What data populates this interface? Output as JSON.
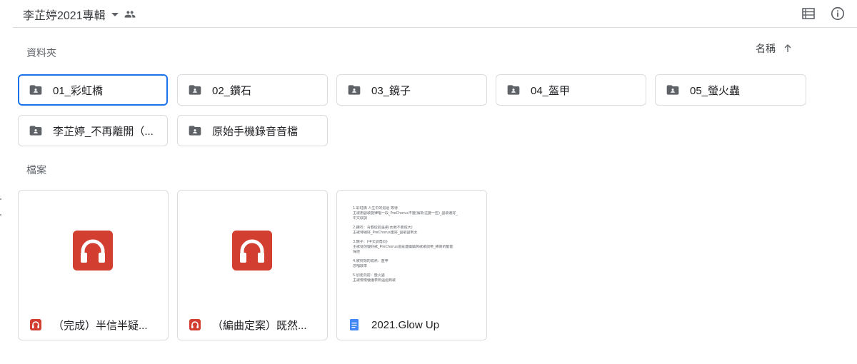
{
  "header": {
    "title": "李芷婷2021專輯",
    "icons": {
      "dropdown": "caret-down-icon",
      "shared": "people-icon",
      "view": "list-view-icon",
      "info": "info-icon"
    }
  },
  "folders_section": {
    "label": "資料夾",
    "sort": {
      "label": "名稱",
      "direction": "ascending",
      "icon": "arrow-up-icon"
    },
    "folders": [
      {
        "name": "01_彩虹橋",
        "icon": "shared-folder-icon",
        "selected": true
      },
      {
        "name": "02_鑽石",
        "icon": "shared-folder-icon"
      },
      {
        "name": "03_鏡子",
        "icon": "shared-folder-icon"
      },
      {
        "name": "04_盔甲",
        "icon": "shared-folder-icon"
      },
      {
        "name": "05_螢火蟲",
        "icon": "shared-folder-icon"
      },
      {
        "name": "李芷婷_不再離開（...",
        "icon": "shared-folder-icon"
      },
      {
        "name": "原始手機錄音音檔",
        "icon": "shared-folder-icon"
      }
    ]
  },
  "files_section": {
    "label": "檔案",
    "files": [
      {
        "name": "（完成）半信半疑...",
        "type": "audio",
        "icon": "headphones-icon"
      },
      {
        "name": "（編曲定案）既然...",
        "type": "audio",
        "icon": "headphones-icon"
      },
      {
        "name": "2021.Glow Up",
        "type": "document",
        "icon": "google-docs-icon",
        "preview_lines": [
          "1.彩虹橋 人生中的追逐 等待",
          "主歌用副歌旋律唱一段_PreChorus不變(解析這變一些)_副歌選好_",
          "中文取調",
          "",
          "2.鑽石：青春從前溫柔(而我不要成大)",
          "主歌待絕好_PreChorus重好_副歌副到太",
          "",
          "3.鏡子：(中文調角同)",
          "主歌從前優好歌_PreChorus還是連續續高歌歌調帶_稀高的動能",
          "保證",
          "",
          "4.被封閉的成熟：盔甲",
          "念唱敲準",
          "",
          "5.別走向前：螢火蟲",
          "主歌慢慢優優表到溫過到歌"
        ]
      }
    ]
  },
  "colors": {
    "accent": "#1a73e8",
    "audio_red": "#d23f31",
    "docs_blue": "#4285f4",
    "border": "#dadce0",
    "icon_grey": "#5f6368"
  }
}
